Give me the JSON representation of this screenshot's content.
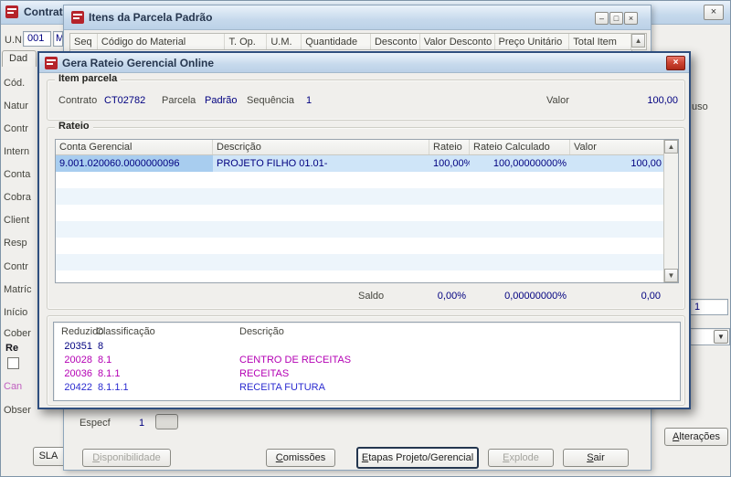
{
  "icons": {
    "close": "×",
    "minimize": "–",
    "restore": "□",
    "arrow_up": "▲",
    "arrow_down": "▼",
    "dropdown": "▼"
  },
  "contratos": {
    "title": "Contratos",
    "un_label": "U.N.",
    "un_value": "001",
    "un_fragment": "M",
    "tab_fragment": "Dad",
    "left_labels": [
      "Cód.",
      "Natur",
      "Contr",
      "Intern",
      "Conta",
      "Cobra",
      "Client",
      "Resp",
      "Contr",
      "Matríc",
      "Início",
      "Cober"
    ],
    "renewal_fragment": "Re",
    "cancel_fragment": "Can",
    "obs_fragment": "Obser",
    "uso_fragment": "uso",
    "field_value": "1",
    "alteracoes_button": "Alterações",
    "sla_fragment": "SLA"
  },
  "itens": {
    "title": "Itens da Parcela Padrão",
    "grid_columns": [
      "Seq",
      "Código do Material",
      "T. Op.",
      "U.M.",
      "Quantidade",
      "Desconto",
      "Valor Desconto",
      "Preço Unitário",
      "Total Item"
    ],
    "especif_label": "Especf",
    "especif_value": "1",
    "buttons": {
      "disponibilidade": "Disponibilidade",
      "comissoes": "Comissões",
      "etapas": "Etapas Projeto/Gerencial",
      "explode": "Explode",
      "sair": "Sair"
    }
  },
  "dialog": {
    "title": "Gera Rateio Gerencial Online",
    "item_parcela": {
      "group_label": "Item parcela",
      "contrato_label": "Contrato",
      "contrato_value": "CT02782",
      "parcela_label": "Parcela",
      "parcela_value": "Padrão",
      "sequencia_label": "Sequência",
      "sequencia_value": "1",
      "valor_label": "Valor",
      "valor_value": "100,00"
    },
    "rateio": {
      "group_label": "Rateio",
      "columns": [
        "Conta Gerencial",
        "Descrição",
        "Rateio",
        "Rateio Calculado",
        "Valor"
      ],
      "row": {
        "conta": "9.001.020060.0000000096",
        "descricao": "PROJETO FILHO 01.01-",
        "rateio": "100,00%",
        "rateio_calculado": "100,00000000%",
        "valor": "100,00"
      },
      "saldo_label": "Saldo",
      "saldo_rateio": "0,00%",
      "saldo_rateio_calculado": "0,00000000%",
      "saldo_valor": "0,00"
    },
    "classificacao": {
      "columns": [
        "Reduzido",
        "Classificação",
        "Descrição"
      ],
      "rows": [
        {
          "reduzido": "20351",
          "classificacao": "8",
          "descricao": ""
        },
        {
          "reduzido": "20028",
          "classificacao": "8.1",
          "descricao": "CENTRO DE RECEITAS"
        },
        {
          "reduzido": "20036",
          "classificacao": "8.1.1",
          "descricao": "RECEITAS"
        },
        {
          "reduzido": "20422",
          "classificacao": "8.1.1.1",
          "descricao": "RECEITA FUTURA"
        }
      ]
    }
  }
}
